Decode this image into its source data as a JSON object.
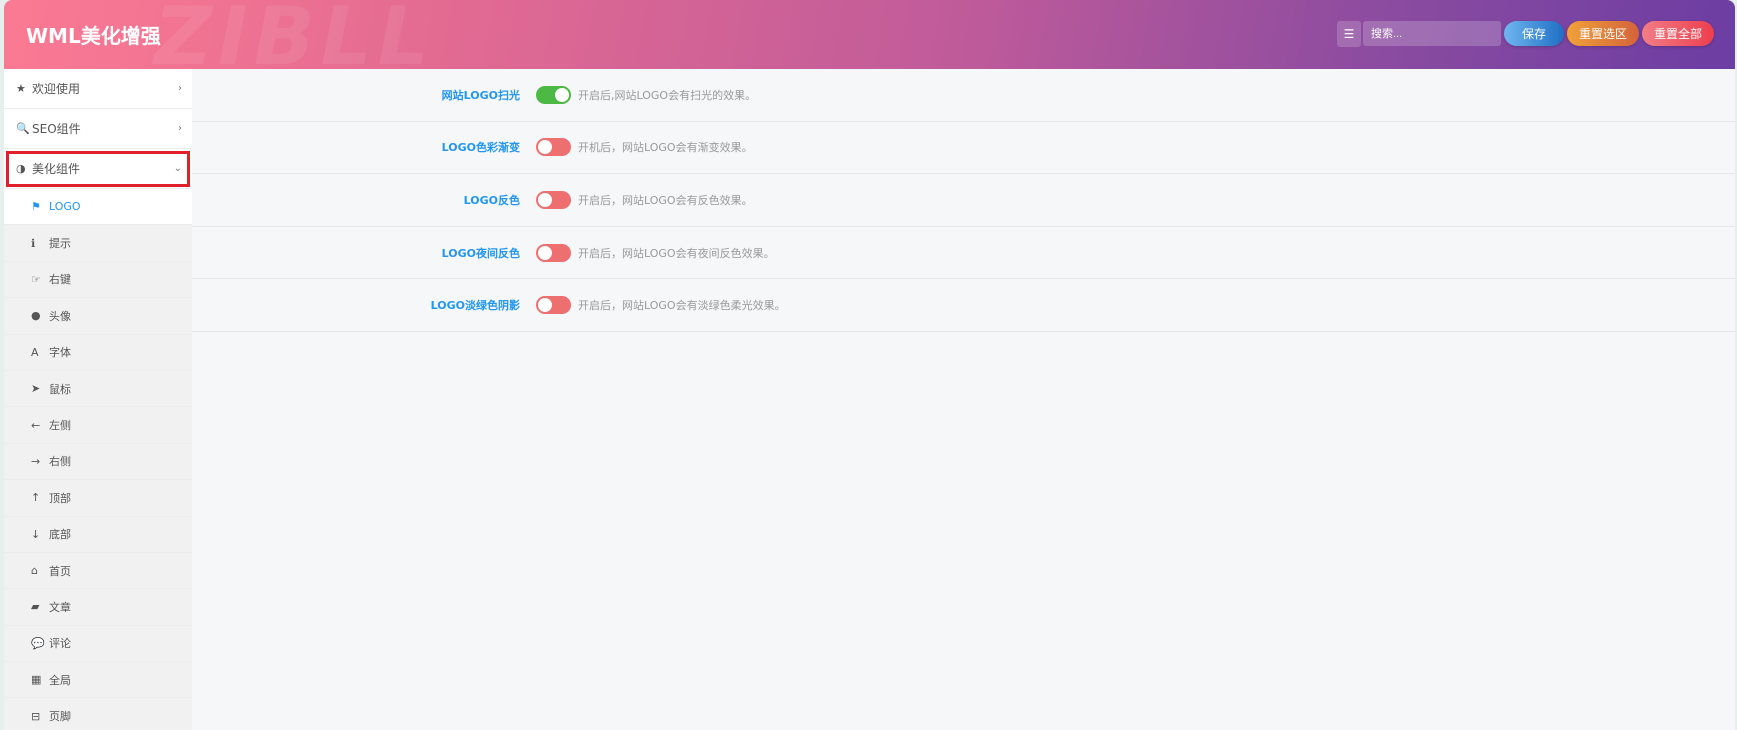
{
  "header": {
    "title": "WML美化增强",
    "watermark": "ZIBLL",
    "search_placeholder": "搜索...",
    "save": "保存",
    "reset_section": "重置选区",
    "reset_all": "重置全部"
  },
  "sidebar": {
    "top": [
      {
        "icon": "★",
        "label": "欢迎使用"
      },
      {
        "icon": "🔍",
        "label": "SEO组件"
      },
      {
        "icon": "◑",
        "label": "美化组件"
      }
    ],
    "subs": [
      {
        "icon": "⚑",
        "label": "LOGO"
      },
      {
        "icon": "ℹ",
        "label": "提示"
      },
      {
        "icon": "☞",
        "label": "右键"
      },
      {
        "icon": "●",
        "label": "头像"
      },
      {
        "icon": "A",
        "label": "字体"
      },
      {
        "icon": "➤",
        "label": "鼠标"
      },
      {
        "icon": "←",
        "label": "左侧"
      },
      {
        "icon": "→",
        "label": "右侧"
      },
      {
        "icon": "↑",
        "label": "顶部"
      },
      {
        "icon": "↓",
        "label": "底部"
      },
      {
        "icon": "⌂",
        "label": "首页"
      },
      {
        "icon": "▰",
        "label": "文章"
      },
      {
        "icon": "💬",
        "label": "评论"
      },
      {
        "icon": "▦",
        "label": "全局"
      },
      {
        "icon": "⊟",
        "label": "页脚"
      }
    ]
  },
  "settings": [
    {
      "label": "网站LOGO扫光",
      "on": true,
      "desc": "开启后,网站LOGO会有扫光的效果。"
    },
    {
      "label": "LOGO色彩渐变",
      "on": false,
      "desc": "开机后，网站LOGO会有渐变效果。"
    },
    {
      "label": "LOGO反色",
      "on": false,
      "desc": "开启后，网站LOGO会有反色效果。"
    },
    {
      "label": "LOGO夜间反色",
      "on": false,
      "desc": "开启后，网站LOGO会有夜间反色效果。"
    },
    {
      "label": "LOGO淡绿色阴影",
      "on": false,
      "desc": "开启后，网站LOGO会有淡绿色柔光效果。"
    }
  ],
  "colors": {
    "on": "#4cb944",
    "off": "#ee6f6f",
    "accent": "#2196f3"
  }
}
